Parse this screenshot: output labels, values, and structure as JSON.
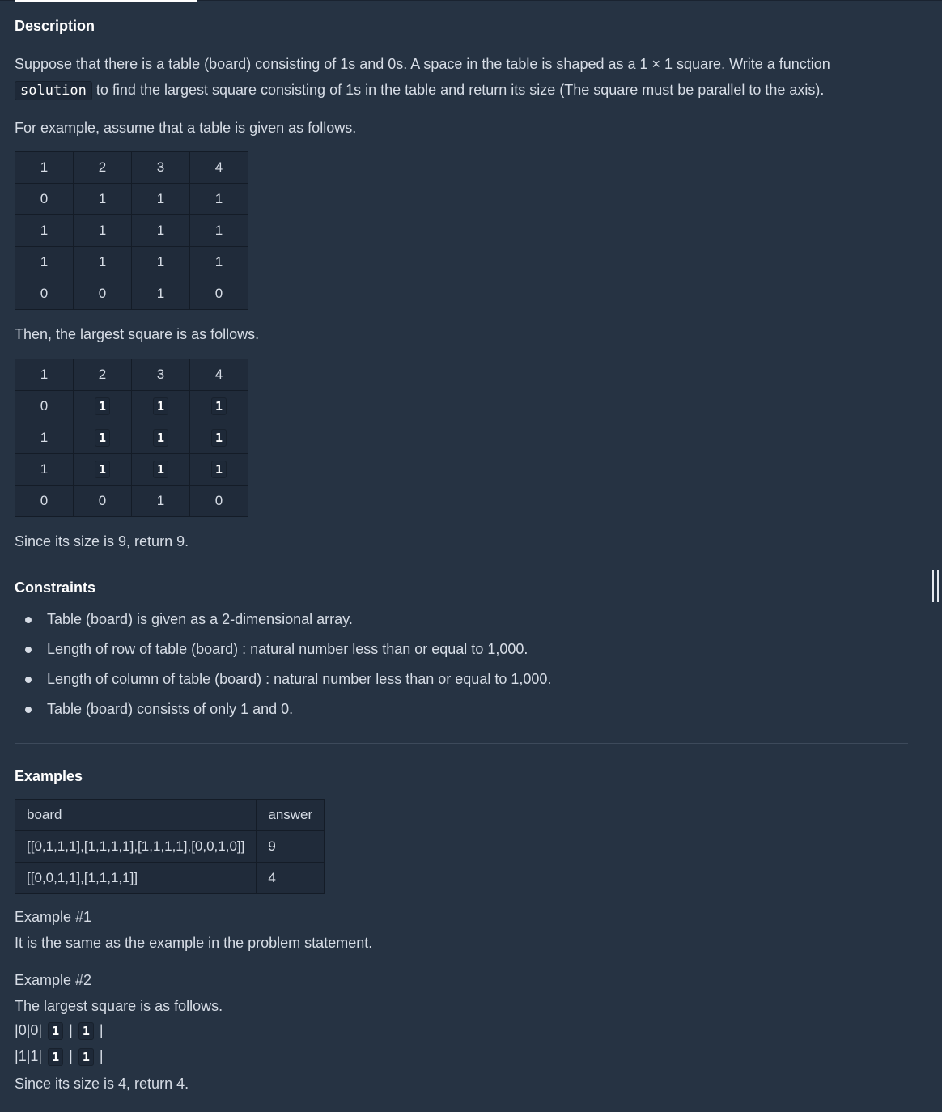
{
  "description": {
    "heading": "Description",
    "para1_before": "Suppose that there is a table (board) consisting of 1s and 0s. A space in the table is shaped as a 1 × 1 square. Write a function",
    "para1_code": "solution",
    "para1_after": "to find the largest square consisting of 1s in the table and return its size (The square must be parallel to the axis).",
    "para2": "For example, assume that a table is given as follows.",
    "table1": [
      [
        "1",
        "2",
        "3",
        "4"
      ],
      [
        "0",
        "1",
        "1",
        "1"
      ],
      [
        "1",
        "1",
        "1",
        "1"
      ],
      [
        "1",
        "1",
        "1",
        "1"
      ],
      [
        "0",
        "0",
        "1",
        "0"
      ]
    ],
    "para3": "Then, the largest square is as follows.",
    "table2": [
      [
        "1",
        "2",
        "3",
        "4"
      ],
      [
        "0",
        "1",
        "1",
        "1"
      ],
      [
        "1",
        "1",
        "1",
        "1"
      ],
      [
        "1",
        "1",
        "1",
        "1"
      ],
      [
        "0",
        "0",
        "1",
        "0"
      ]
    ],
    "table2_highlight": [
      [
        1,
        1
      ],
      [
        1,
        2
      ],
      [
        1,
        3
      ],
      [
        2,
        1
      ],
      [
        2,
        2
      ],
      [
        2,
        3
      ],
      [
        3,
        1
      ],
      [
        3,
        2
      ],
      [
        3,
        3
      ]
    ],
    "para4": "Since its size is 9, return 9."
  },
  "constraints": {
    "heading": "Constraints",
    "items": [
      "Table (board) is given as a 2-dimensional array.",
      "Length of row of table (board) : natural number less than or equal to 1,000.",
      "Length of column of table (board) : natural number less than or equal to 1,000.",
      "Table (board) consists of only 1 and 0."
    ]
  },
  "examples": {
    "heading": "Examples",
    "columns": [
      "board",
      "answer"
    ],
    "rows": [
      [
        "[[0,1,1,1],[1,1,1,1],[1,1,1,1],[0,0,1,0]]",
        "9"
      ],
      [
        "[[0,0,1,1],[1,1,1,1]]",
        "4"
      ]
    ],
    "ex1_title": "Example #1",
    "ex1_text": "It is the same as the example in the problem statement.",
    "ex2_title": "Example #2",
    "ex2_text": "The largest square is as follows.",
    "ex2_rows": [
      [
        "0",
        "0",
        "1",
        "1"
      ],
      [
        "1",
        "1",
        "1",
        "1"
      ]
    ],
    "ex2_highlight_cols": [
      2,
      3
    ],
    "ex2_result": "Since its size is 4, return 4."
  }
}
